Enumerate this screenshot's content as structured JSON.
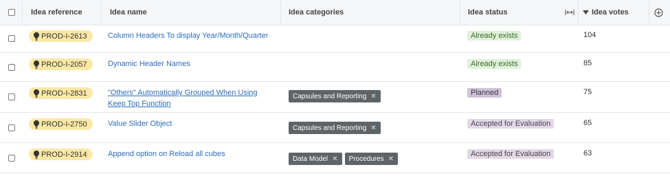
{
  "columns": {
    "reference": "Idea reference",
    "name": "Idea name",
    "categories": "Idea categories",
    "status": "Idea status",
    "votes": "Idea votes"
  },
  "header_icons": {
    "sort": "sort-descending-icon",
    "resize": "column-resize-icon",
    "add": "add-column-icon"
  },
  "status_colors": {
    "Already exists": {
      "bg": "#dff0d8",
      "fg": "#3c6b2f"
    },
    "Planned": {
      "bg": "#cfc3d6",
      "fg": "#3d3348"
    },
    "Accepted for Evaluation": {
      "bg": "#e2d8e4",
      "fg": "#4a3f52"
    }
  },
  "rows": [
    {
      "ref": "PROD-I-2613",
      "name": "Column Headers To display Year/Month/Quarter",
      "categories": [],
      "status": "Already exists",
      "votes": "104"
    },
    {
      "ref": "PROD-I-2057",
      "name": "Dynamic Header Names",
      "categories": [],
      "status": "Already exists",
      "votes": "85"
    },
    {
      "ref": "PROD-I-2831",
      "name": "\"Others\" Automatically Grouped When Using Keep Top Function",
      "categories": [
        "Capsules and Reporting"
      ],
      "status": "Planned",
      "votes": "75"
    },
    {
      "ref": "PROD-I-2750",
      "name": "Value Slider Object",
      "categories": [
        "Capsules and Reporting"
      ],
      "status": "Accepted for Evaluation",
      "votes": "65"
    },
    {
      "ref": "PROD-I-2914",
      "name": "Append option on Reload all cubes",
      "categories": [
        "Data Model",
        "Procedures"
      ],
      "status": "Accepted for Evaluation",
      "votes": "63"
    }
  ]
}
